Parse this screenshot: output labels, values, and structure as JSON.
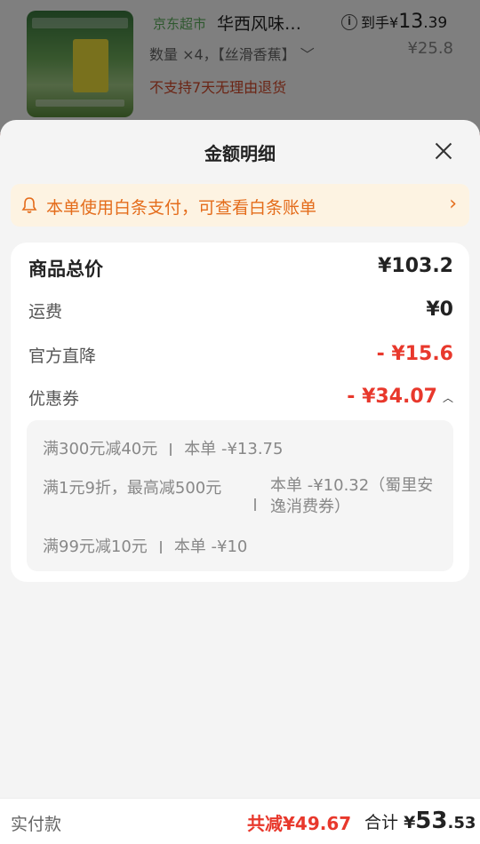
{
  "background_product": {
    "store_tag": "京东超市",
    "title": "华西风味…",
    "deliver_label": "到手",
    "deliver_currency": "¥",
    "deliver_int": "13",
    "deliver_dec": ".39",
    "quantity_text": "数量 ×4，【丝滑香蕉】",
    "original_price": "¥25.8",
    "return_note": "不支持7天无理由退货"
  },
  "sheet": {
    "title": "金额明细",
    "notice": "本单使用白条支付，可查看白条账单",
    "rows": {
      "total_label": "商品总价",
      "total_value": "¥103.2",
      "shipping_label": "运费",
      "shipping_value": "¥0",
      "discount_label": "官方直降",
      "discount_value": "- ¥15.6",
      "coupon_label": "优惠券",
      "coupon_value": "- ¥34.07"
    },
    "coupons": [
      {
        "rule": "满300元减40元",
        "amount": "本单 -¥13.75"
      },
      {
        "rule": "满1元9折，最高减500元",
        "amount": "本单 -¥10.32（蜀里安逸消费券）"
      },
      {
        "rule": "满99元减10元",
        "amount": "本单 -¥10"
      }
    ]
  },
  "footer": {
    "label": "实付款",
    "saved": "共减¥49.67",
    "total_label": "合计",
    "total_currency": "¥",
    "total_int": "53",
    "total_dec": ".53"
  },
  "colors": {
    "accent_red": "#e8382c",
    "notice_bg": "#fdf3e2",
    "notice_text": "#e46c1b"
  },
  "icons": [
    "info-icon",
    "chevron-down-icon",
    "close-icon",
    "bell-icon",
    "chevron-right-icon",
    "chevron-up-icon"
  ]
}
